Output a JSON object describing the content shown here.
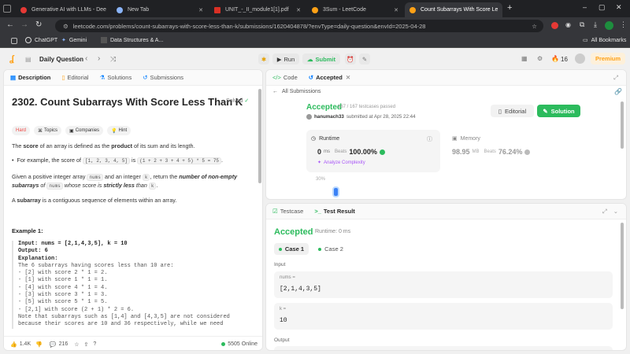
{
  "browser": {
    "tabs": [
      {
        "label": "Generative AI with LLMs - Dee",
        "color": "#e53935"
      },
      {
        "label": "New Tab",
        "color": "#8ab4f8"
      },
      {
        "label": "UNIT_-_II_module1[1].pdf",
        "color": "#d93025"
      },
      {
        "label": "3Sum - LeetCode",
        "color": "#ffa116"
      },
      {
        "label": "Count Subarrays With Score Le",
        "color": "#ffa116"
      }
    ],
    "new_tab": "+",
    "url": "leetcode.com/problems/count-subarrays-with-score-less-than-k/submissions/1620404878/?envType=daily-question&envId=2025-04-28",
    "bookmarks": [
      "ChatGPT",
      "Gemini",
      "Data Structures & A..."
    ],
    "all_bookmarks": "All Bookmarks"
  },
  "nav": {
    "daily": "Daily Question",
    "run": "Run",
    "submit": "Submit",
    "streak": "16",
    "premium": "Premium"
  },
  "left": {
    "tabs": [
      "Description",
      "Editorial",
      "Solutions",
      "Submissions"
    ],
    "title": "2302. Count Subarrays With Score Less Than K",
    "solved": "Solved",
    "tags": [
      "Hard",
      "Topics",
      "Companies",
      "Hint"
    ],
    "p1_a": "The ",
    "p1_b": "score",
    "p1_c": " of an array is defined as the ",
    "p1_d": "product",
    "p1_e": " of its sum and its length.",
    "bullet_a": "For example, the score of ",
    "bullet_code1": "[1, 2, 3, 4, 5]",
    "bullet_b": " is ",
    "bullet_code2": "(1 + 2 + 3 + 4 + 5) * 5 = 75",
    "bullet_c": ".",
    "p2_a": "Given a positive integer array ",
    "p2_code1": "nums",
    "p2_b": " and an integer ",
    "p2_code2": "k",
    "p2_c": ", return the ",
    "p2_d": "number of non-empty subarrays",
    "p2_e": " of ",
    "p2_code3": "nums",
    "p2_f": " whose score is ",
    "p2_g": "strictly less",
    "p2_h": " than ",
    "p2_code4": "k",
    "p2_i": ".",
    "p3_a": "A ",
    "p3_b": "subarray",
    "p3_c": " is a contiguous sequence of elements within an array.",
    "example_title": "Example 1:",
    "example_lines": [
      "Input: nums = [2,1,4,3,5], k = 10",
      "Output: 6",
      "Explanation:",
      "The 6 subarrays having scores less than 10 are:",
      "- [2] with score 2 * 1 = 2.",
      "- [1] with score 1 * 1 = 1.",
      "- [4] with score 4 * 1 = 4.",
      "- [3] with score 3 * 1 = 3.",
      "- [5] with score 5 * 1 = 5.",
      "- [2,1] with score (2 + 1) * 2 = 6.",
      "Note that subarrays such as [1,4] and [4,3,5] are not considered",
      "because their scores are 10 and 36 respectively, while we need"
    ],
    "likes": "1.4K",
    "comments": "216",
    "online": "5505 Online"
  },
  "submission": {
    "tabs": [
      "Code",
      "Accepted"
    ],
    "back": "All Submissions",
    "status": "Accepted",
    "testcases": "167 / 167 testcases passed",
    "user": "hanumach33",
    "submitted": "submitted at Apr 28, 2025 22:44",
    "editorial": "Editorial",
    "solution": "Solution",
    "runtime_label": "Runtime",
    "runtime_value": "0",
    "runtime_unit": "ms",
    "beats": "Beats",
    "runtime_beats": "100.00%",
    "analyze": "Analyze Complexity",
    "memory_label": "Memory",
    "memory_value": "98.95",
    "memory_unit": "MB",
    "memory_beats": "76.24%",
    "chart_tick": "30%"
  },
  "console": {
    "tabs": [
      "Testcase",
      "Test Result"
    ],
    "status": "Accepted",
    "runtime": "Runtime: 0 ms",
    "cases": [
      "Case 1",
      "Case 2"
    ],
    "input_label": "Input",
    "var1_name": "nums =",
    "var1_value": "[2,1,4,3,5]",
    "var2_name": "k =",
    "var2_value": "10",
    "output_label": "Output"
  }
}
